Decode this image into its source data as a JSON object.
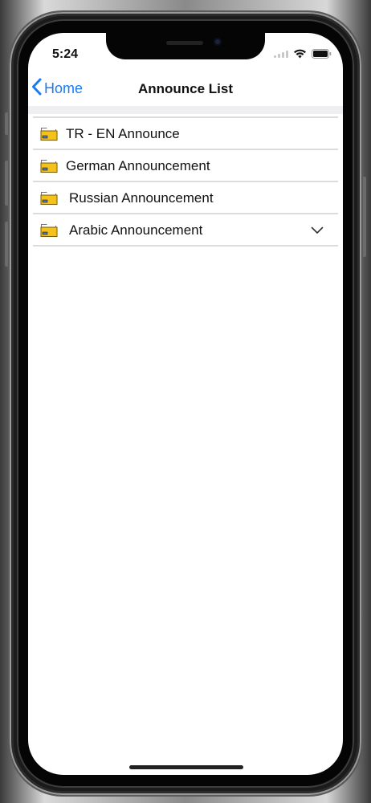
{
  "status_bar": {
    "time": "5:24"
  },
  "nav": {
    "back_label": "Home",
    "title": "Announce List"
  },
  "announcements": [
    {
      "label": "TR - EN Announce",
      "has_chevron": false
    },
    {
      "label": "German Announcement",
      "has_chevron": false
    },
    {
      "label": "Russian Announcement",
      "has_chevron": false
    },
    {
      "label": "Arabic Announcement",
      "has_chevron": true
    }
  ],
  "icons": {
    "back": "chevron-left-icon",
    "folder": "folder-icon",
    "expand": "chevron-down-icon"
  },
  "colors": {
    "accent": "#1a7cf5",
    "folder_yellow": "#f4c21a",
    "folder_red": "#e04444"
  }
}
